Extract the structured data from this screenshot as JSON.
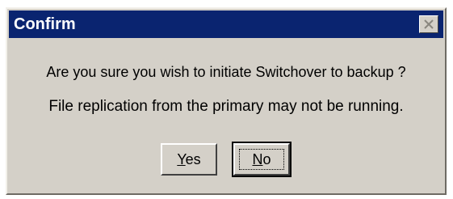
{
  "dialog": {
    "title": "Confirm",
    "close_icon": "close-x-icon",
    "message_line1": "Are you sure you wish to initiate Switchover to backup ?",
    "message_line2": "File replication from the primary may not be running.",
    "buttons": {
      "yes": {
        "mnemonic": "Y",
        "rest": "es"
      },
      "no": {
        "mnemonic": "N",
        "rest": "o"
      }
    }
  },
  "colors": {
    "titlebar": "#0a2470",
    "face": "#d4d0c8",
    "title_text": "#ffffff"
  }
}
